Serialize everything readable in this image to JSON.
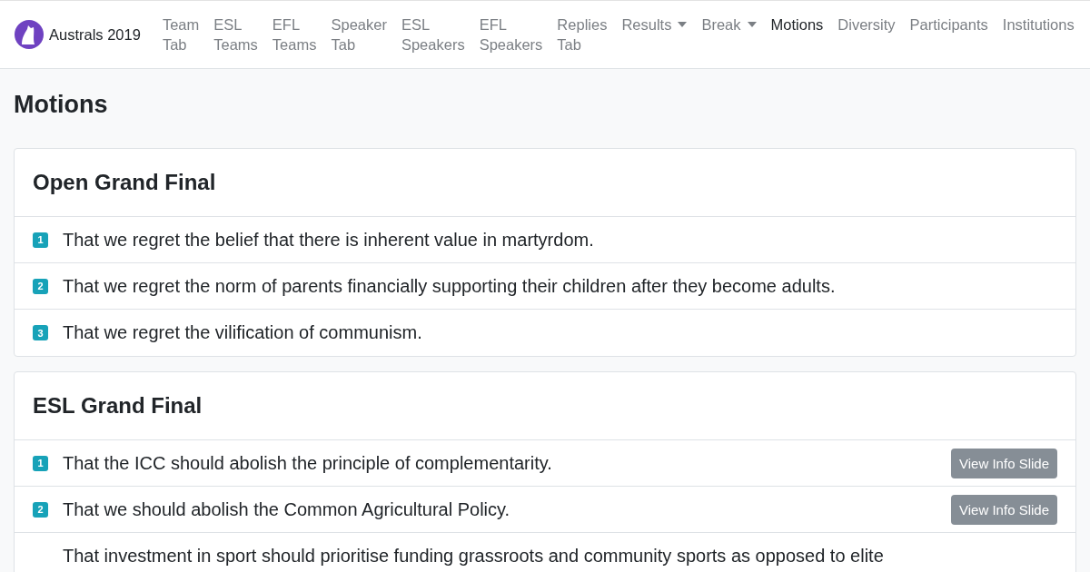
{
  "brand": {
    "name": "Australs 2019"
  },
  "nav": [
    {
      "label": "Team Tab",
      "selected": false,
      "dropdown": false
    },
    {
      "label": "ESL Teams",
      "selected": false,
      "dropdown": false
    },
    {
      "label": "EFL Teams",
      "selected": false,
      "dropdown": false
    },
    {
      "label": "Speaker Tab",
      "selected": false,
      "dropdown": false
    },
    {
      "label": "ESL Speakers",
      "selected": false,
      "dropdown": false
    },
    {
      "label": "EFL Speakers",
      "selected": false,
      "dropdown": false
    },
    {
      "label": "Replies Tab",
      "selected": false,
      "dropdown": false
    },
    {
      "label": "Results",
      "selected": false,
      "dropdown": true
    },
    {
      "label": "Break",
      "selected": false,
      "dropdown": true
    },
    {
      "label": "Motions",
      "selected": true,
      "dropdown": false
    },
    {
      "label": "Diversity",
      "selected": false,
      "dropdown": false
    },
    {
      "label": "Participants",
      "selected": false,
      "dropdown": false
    },
    {
      "label": "Institutions",
      "selected": false,
      "dropdown": false
    }
  ],
  "page_title": "Motions",
  "rounds": [
    {
      "title": "Open Grand Final",
      "motions": [
        {
          "number": "1",
          "text": "That we regret the belief that there is inherent value in martyrdom."
        },
        {
          "number": "2",
          "text": "That we regret the norm of parents financially supporting their children after they become adults."
        },
        {
          "number": "3",
          "text": "That we regret the vilification of communism."
        }
      ]
    },
    {
      "title": "ESL Grand Final",
      "motions": [
        {
          "number": "1",
          "text": "That the ICC should abolish the principle of complementarity.",
          "button": "View Info Slide"
        },
        {
          "number": "2",
          "text": "That we should abolish the Common Agricultural Policy.",
          "button": "View Info Slide"
        },
        {
          "text": "That investment in sport should prioritise funding grassroots and community sports as opposed to elite"
        }
      ]
    }
  ]
}
